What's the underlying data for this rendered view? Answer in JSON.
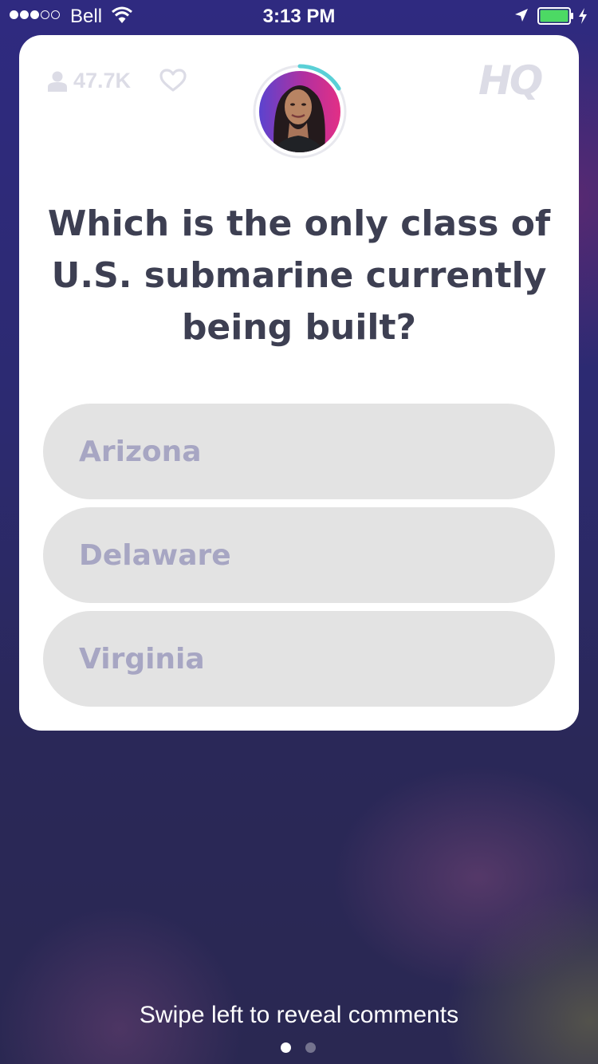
{
  "status_bar": {
    "carrier": "Bell",
    "time": "3:13 PM",
    "signal_bars_filled": 3,
    "signal_bars_total": 5,
    "battery_color": "#4cd964"
  },
  "game": {
    "viewer_count": "47.7K",
    "logo_text": "HQ",
    "timer_accent_color": "#5ad0d6",
    "question": "Which is the only class of U.S. submarine currently being built?",
    "answers": [
      {
        "label": "Arizona"
      },
      {
        "label": "Delaware"
      },
      {
        "label": "Virginia"
      }
    ]
  },
  "footer": {
    "hint": "Swipe left to reveal comments",
    "pages_total": 2,
    "active_page": 1
  },
  "icons": [
    "person-icon",
    "heart-icon",
    "wifi-icon",
    "location-icon",
    "battery-icon",
    "bolt-icon"
  ]
}
